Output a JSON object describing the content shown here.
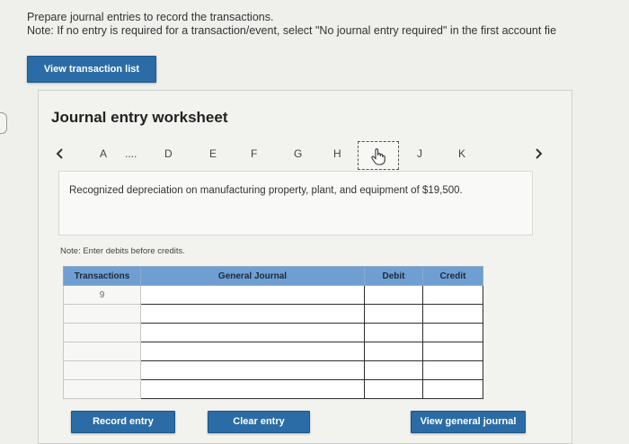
{
  "instructions": {
    "line1": "Prepare journal entries to record the transactions.",
    "line2": "Note: If no entry is required for a transaction/event, select \"No journal entry required\" in the first account fie"
  },
  "buttons": {
    "view_transaction_list": "View transaction list",
    "record_entry": "Record entry",
    "clear_entry": "Clear entry",
    "view_general_journal": "View general journal"
  },
  "worksheet": {
    "title": "Journal entry worksheet",
    "nav": {
      "items": [
        "A",
        "....",
        "D",
        "E",
        "F",
        "G",
        "H",
        "J",
        "K"
      ],
      "current_icon": "hand-pointer-icon",
      "prev_icon": "chevron-left-icon",
      "next_icon": "chevron-right-icon"
    },
    "description": "Recognized depreciation on manufacturing property, plant, and equipment of $19,500.",
    "note": "Note: Enter debits before credits.",
    "table": {
      "headers": {
        "transactions": "Transactions",
        "general_journal": "General Journal",
        "debit": "Debit",
        "credit": "Credit"
      },
      "rows": [
        {
          "transaction": "9",
          "account": "",
          "debit": "",
          "credit": ""
        },
        {
          "transaction": "",
          "account": "",
          "debit": "",
          "credit": ""
        },
        {
          "transaction": "",
          "account": "",
          "debit": "",
          "credit": ""
        },
        {
          "transaction": "",
          "account": "",
          "debit": "",
          "credit": ""
        },
        {
          "transaction": "",
          "account": "",
          "debit": "",
          "credit": ""
        },
        {
          "transaction": "",
          "account": "",
          "debit": "",
          "credit": ""
        }
      ]
    }
  },
  "colors": {
    "button": "#2b6ca6",
    "table_header": "#6f9fd2",
    "background": "#efefec"
  }
}
